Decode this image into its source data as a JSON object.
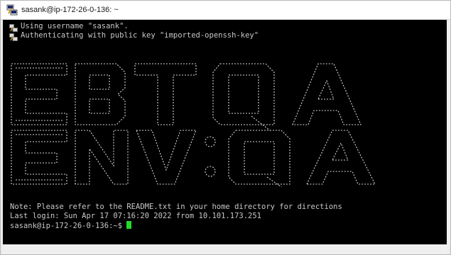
{
  "window": {
    "title": "sasank@ip-172-26-0-136: ~",
    "icon": "putty-icon"
  },
  "terminal": {
    "lines": [
      "Using username \"sasank\".",
      "Authenticating with public key \"imported-openssh-key\""
    ],
    "banner": [
      "EBT QA",
      "ENV:QA"
    ],
    "footer_lines": [
      "Note: Please refer to the README.txt in your home directory for directions",
      "Last login: Sun Apr 17 07:16:20 2022 from 10.101.173.251"
    ],
    "prompt": "sasank@ip-172-26-0-136:~$ ",
    "cursor_color": "#1fdc2b"
  }
}
